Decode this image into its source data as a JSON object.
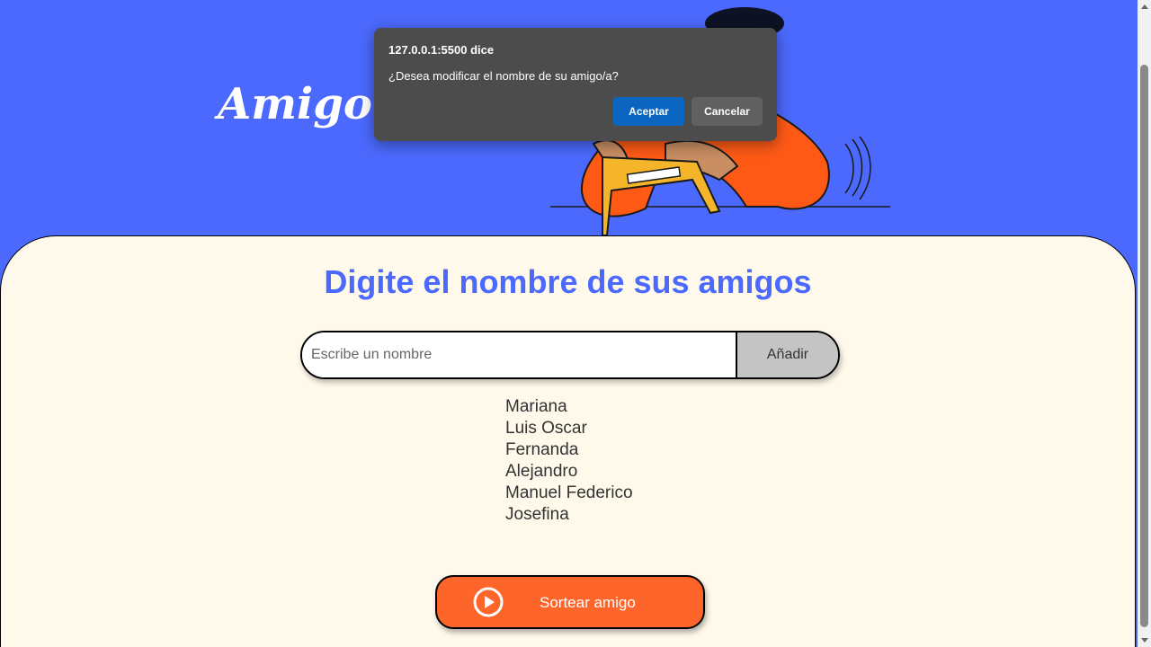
{
  "header": {
    "title": "Amigo S"
  },
  "main": {
    "heading": "Digite el nombre de sus amigos",
    "input": {
      "placeholder": "Escribe un nombre",
      "value": ""
    },
    "add_button_label": "Añadir",
    "friends": [
      "Mariana",
      "Luis Oscar",
      "Fernanda",
      "Alejandro",
      "Manuel Federico",
      "Josefina"
    ],
    "draw_button": {
      "label": "Sortear amigo",
      "icon": "play-circle-icon"
    }
  },
  "dialog": {
    "title": "127.0.0.1:5500 dice",
    "message": "¿Desea modificar el nombre de su amigo/a?",
    "accept_label": "Aceptar",
    "cancel_label": "Cancelar"
  },
  "colors": {
    "header_bg": "#4b69fd",
    "card_bg": "#fff9eb",
    "accent_orange": "#fe652b",
    "heading_blue": "#4b69fd",
    "dialog_bg": "#4c4c4c",
    "accept_blue": "#0b66c2"
  }
}
